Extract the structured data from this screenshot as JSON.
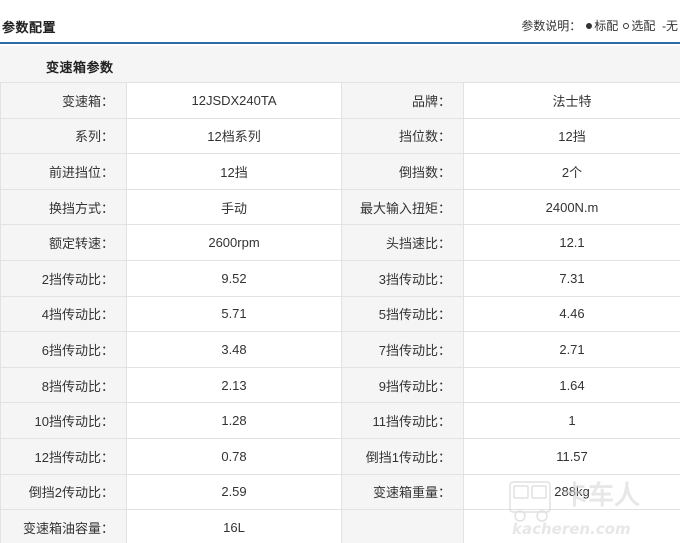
{
  "header": {
    "title": "参数配置",
    "legend_label": "参数说明：",
    "legend_standard": "标配",
    "legend_optional": "选配",
    "legend_none": "-无"
  },
  "section": {
    "title": "变速箱参数"
  },
  "rows": [
    [
      {
        "label": "变速箱：",
        "value": "12JSDX240TA"
      },
      {
        "label": "品牌：",
        "value": "法士特"
      }
    ],
    [
      {
        "label": "系列：",
        "value": "12档系列"
      },
      {
        "label": "挡位数：",
        "value": "12挡"
      }
    ],
    [
      {
        "label": "前进挡位：",
        "value": "12挡"
      },
      {
        "label": "倒挡数：",
        "value": "2个"
      }
    ],
    [
      {
        "label": "换挡方式：",
        "value": "手动"
      },
      {
        "label": "最大输入扭矩：",
        "value": "2400N.m"
      }
    ],
    [
      {
        "label": "额定转速：",
        "value": "2600rpm"
      },
      {
        "label": "头挡速比：",
        "value": "12.1"
      }
    ],
    [
      {
        "label": "2挡传动比：",
        "value": "9.52"
      },
      {
        "label": "3挡传动比：",
        "value": "7.31"
      }
    ],
    [
      {
        "label": "4挡传动比：",
        "value": "5.71"
      },
      {
        "label": "5挡传动比：",
        "value": "4.46"
      }
    ],
    [
      {
        "label": "6挡传动比：",
        "value": "3.48"
      },
      {
        "label": "7挡传动比：",
        "value": "2.71"
      }
    ],
    [
      {
        "label": "8挡传动比：",
        "value": "2.13"
      },
      {
        "label": "9挡传动比：",
        "value": "1.64"
      }
    ],
    [
      {
        "label": "10挡传动比：",
        "value": "1.28"
      },
      {
        "label": "11挡传动比：",
        "value": "1"
      }
    ],
    [
      {
        "label": "12挡传动比：",
        "value": "0.78"
      },
      {
        "label": "倒挡1传动比：",
        "value": "11.57"
      }
    ],
    [
      {
        "label": "倒挡2传动比：",
        "value": "2.59"
      },
      {
        "label": "变速箱重量：",
        "value": "288kg"
      }
    ],
    [
      {
        "label": "变速箱油容量：",
        "value": "16L"
      },
      {
        "label": "",
        "value": ""
      }
    ]
  ],
  "watermark": {
    "text": "卡车人",
    "subtext": "kacheren.com"
  }
}
